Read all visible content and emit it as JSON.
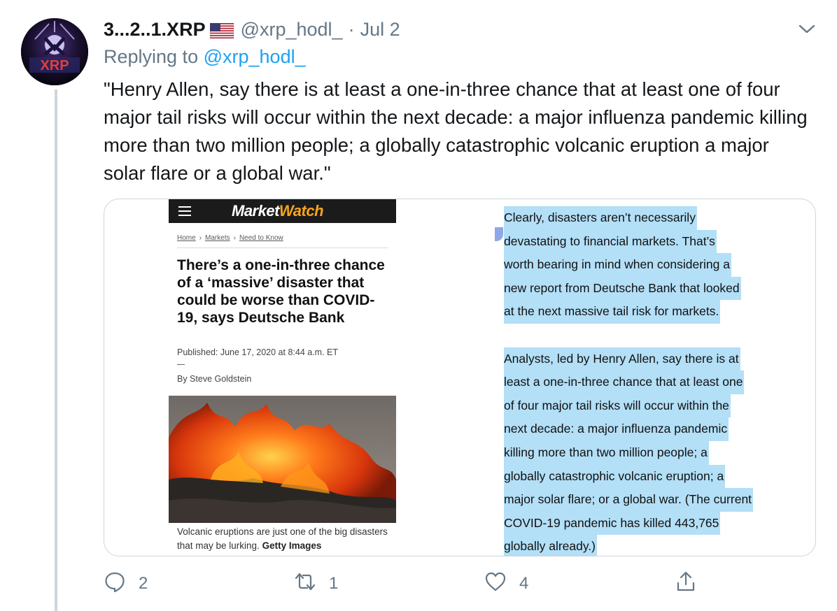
{
  "tweet": {
    "display_name": "3...2..1.XRP",
    "handle": "@xrp_hodl_",
    "separator": "·",
    "date": "Jul 2",
    "replying_prefix": "Replying to",
    "replying_to": "@xrp_hodl_",
    "text": "\"Henry Allen, say there is at least a one-in-three chance that at least one of four major tail risks will occur within the next decade: a major influenza pandemic killing more than two million people; a globally catastrophic volcanic eruption a major solar flare or a global war.\"",
    "avatar_text": "XRP",
    "icons": {
      "flag": "us-flag-icon",
      "caret": "chevron-down-icon",
      "reply": "reply-icon",
      "retweet": "retweet-icon",
      "like": "heart-icon",
      "share": "share-icon"
    },
    "colors": {
      "link": "#1da1f2",
      "muted": "#657786",
      "selection": "#b3dff7",
      "thread_line": "#ccd6dd"
    }
  },
  "article": {
    "logo_market": "Market",
    "logo_watch": "Watch",
    "breadcrumbs": [
      "Home",
      "Markets",
      "Need to Know"
    ],
    "breadcrumb_separator": "›",
    "headline": "There’s a one-in-three chance of a ‘massive’ disaster that could be worse than COVID-19, says Deutsche Bank",
    "published": "Published: June 17, 2020 at 8:44 a.m. ET",
    "byline": "By Steve Goldstein",
    "caption": "Volcanic eruptions are just one of the big disasters that may be lurking.",
    "caption_credit": "Getty Images",
    "selected_lines": [
      "Clearly, disasters aren’t necessarily",
      "devastating to financial markets. That’s",
      "worth bearing in mind when considering a",
      "new report from Deutsche Bank that looked",
      "at the next massive tail risk for markets.",
      "Analysts, led by Henry Allen, say there is at",
      "least a one-in-three chance that at least one",
      "of four major tail risks will occur within the",
      "next decade: a major influenza pandemic",
      "killing more than two million people; a",
      "globally catastrophic volcanic eruption; a",
      "major solar flare; or a global war. (The current",
      "COVID-19 pandemic has killed 443,765",
      "globally already.)"
    ]
  },
  "actions": {
    "reply_count": "2",
    "retweet_count": "1",
    "like_count": "4"
  }
}
